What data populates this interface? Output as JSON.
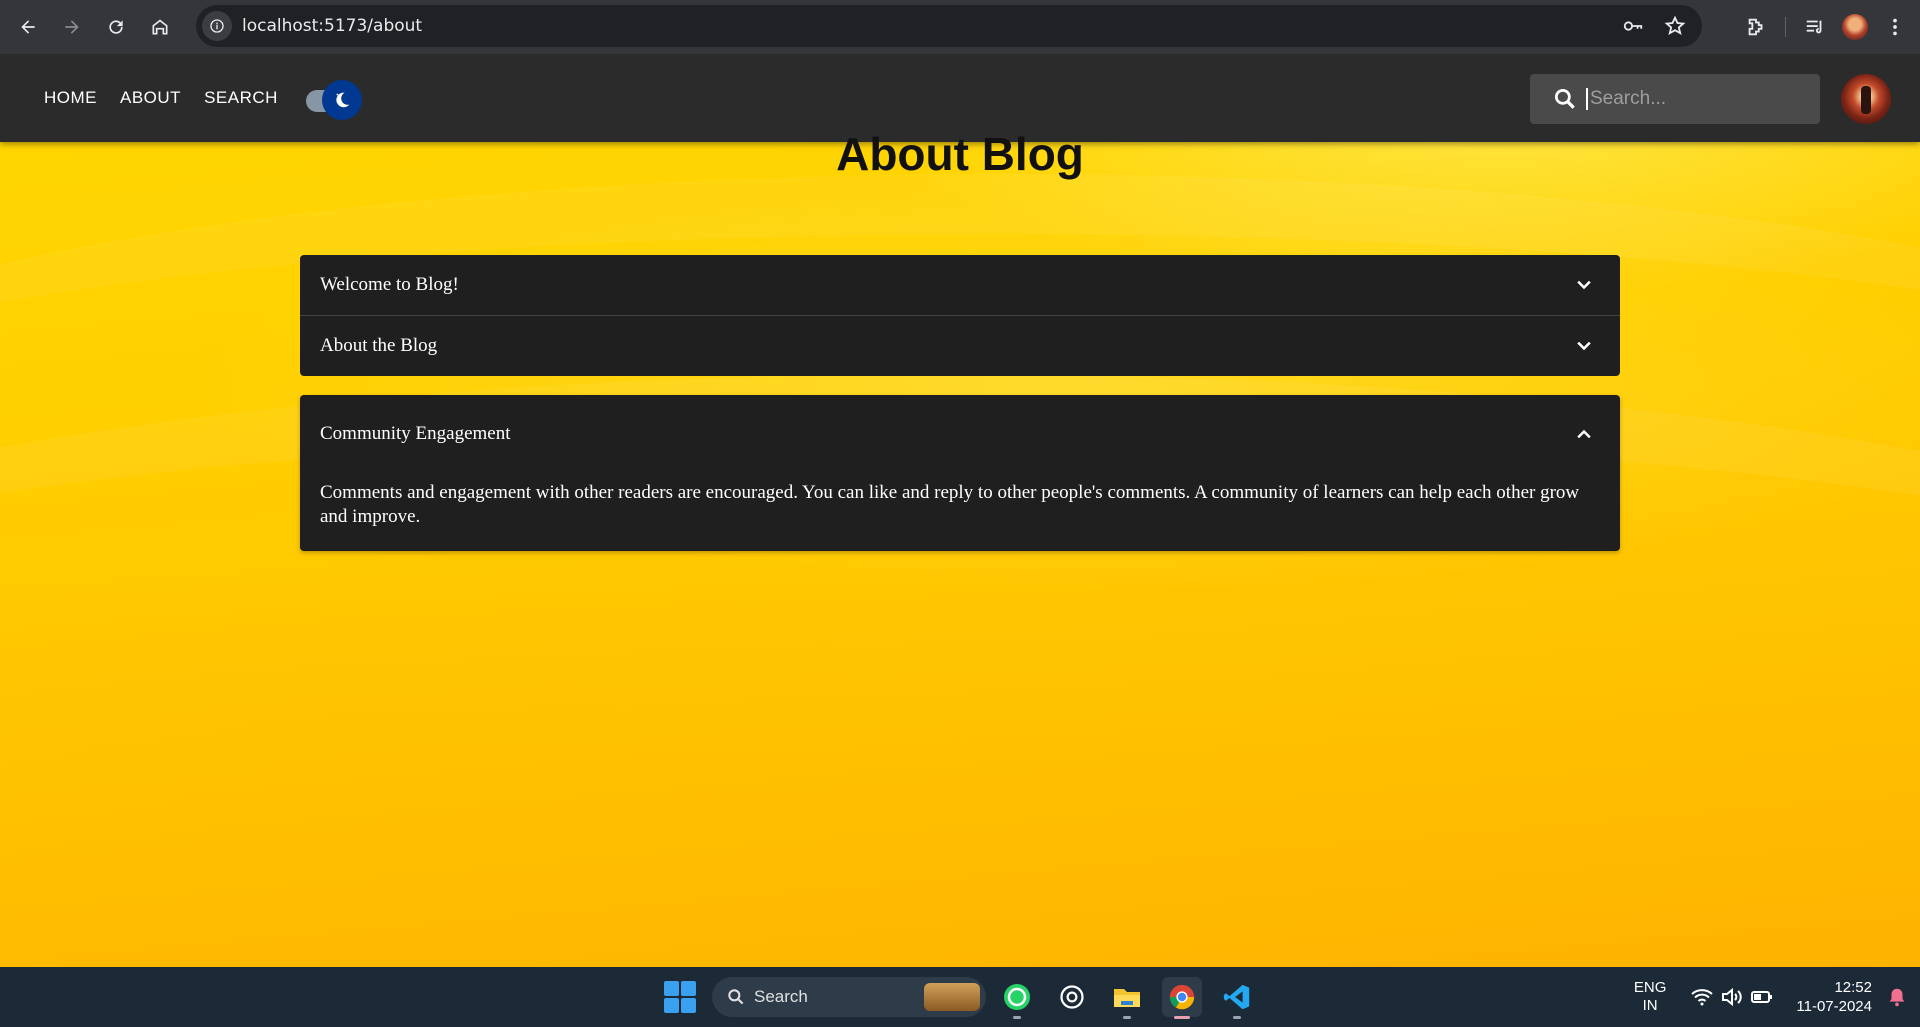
{
  "browser": {
    "url": "localhost:5173/about"
  },
  "app": {
    "nav": {
      "home": "HOME",
      "about": "ABOUT",
      "search": "SEARCH"
    },
    "theme_toggle": "dark",
    "search_placeholder": "Search..."
  },
  "page": {
    "title": "About Blog",
    "accordions": [
      {
        "title": "Welcome to Blog!",
        "expanded": false
      },
      {
        "title": "About the Blog",
        "expanded": false
      },
      {
        "title": "Community Engagement",
        "expanded": true,
        "body": "Comments and engagement with other readers are encouraged. You can like and reply to other people's comments. A community of learners can help each other grow and improve."
      }
    ]
  },
  "taskbar": {
    "search_label": "Search",
    "lang_line1": "ENG",
    "lang_line2": "IN",
    "time": "12:52",
    "date": "11-07-2024"
  },
  "colors": {
    "accent_yellow": "#ffcf00",
    "panel_dark": "#1f1f1f",
    "appbar": "#2b2b2b"
  }
}
